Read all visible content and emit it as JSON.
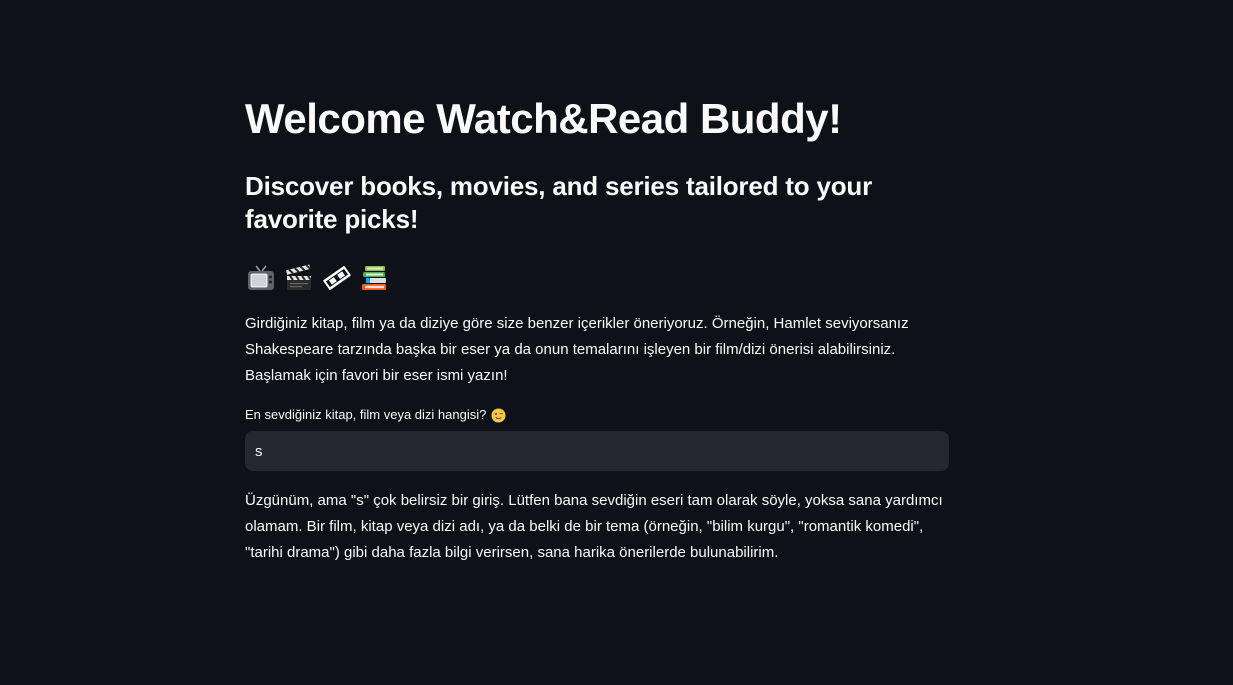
{
  "header": {
    "title": "Welcome Watch&Read Buddy!",
    "subtitle": "Discover books, movies, and series tailored to your favorite picks!"
  },
  "emojis": [
    {
      "icon": "television-icon"
    },
    {
      "icon": "clapper-board-icon"
    },
    {
      "icon": "film-strip-icon"
    },
    {
      "icon": "books-icon"
    }
  ],
  "intro_text": "Girdiğiniz kitap, film ya da diziye göre size benzer içerikler öneriyoruz. Örneğin, Hamlet seviyorsanız Shakespeare tarzında başka bir eser ya da onun temalarını işleyen bir film/dizi önerisi alabilirsiniz. Başlamak için favori bir eser ismi yazın!",
  "input": {
    "label": "En sevdiğiniz kitap, film veya dizi hangisi?",
    "label_icon": "winking-face-icon",
    "value": "s"
  },
  "response_text": "Üzgünüm, ama \"s\" çok belirsiz bir giriş. Lütfen bana sevdiğin eseri tam olarak söyle, yoksa sana yardımcı olamam. Bir film, kitap veya dizi adı, ya da belki de bir tema (örneğin, \"bilim kurgu\", \"romantik komedi\", \"tarihi drama\") gibi daha fazla bilgi verirsen, sana harika önerilerde bulunabilirim.",
  "colors": {
    "background": "#0e1117",
    "text": "#fafafa",
    "input_background": "#262730"
  }
}
